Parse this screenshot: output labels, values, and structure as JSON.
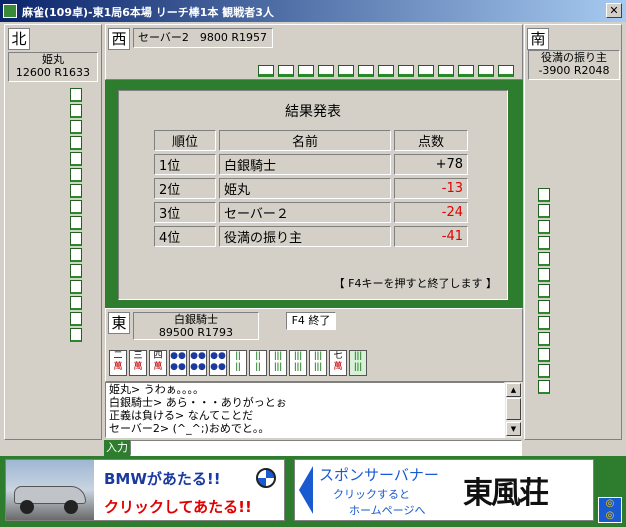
{
  "window": {
    "title": "麻雀(109卓)-東1局6本場 リーチ棒1本 観戦者3人",
    "close_glyph": "✕"
  },
  "north": {
    "wind": "北",
    "name": "姫丸",
    "score": "12600 R1633",
    "tiles_visible": 16
  },
  "west": {
    "wind": "西",
    "name_score": "セーバー2　9800 R1957",
    "tiles_visible": 13
  },
  "south": {
    "wind": "南",
    "name": "役満の振り主",
    "score": "-3900 R2048",
    "tiles_visible": 13
  },
  "east": {
    "wind": "東",
    "name": "白銀騎士",
    "score": "89500 R1793",
    "f4_label": "F4 終了"
  },
  "results": {
    "title": "結果発表",
    "headers": {
      "rank": "順位",
      "name": "名前",
      "points": "点数"
    },
    "rows": [
      {
        "rank": "1位",
        "name": "白銀騎士",
        "points": "+78"
      },
      {
        "rank": "2位",
        "name": "姫丸",
        "points": "-13"
      },
      {
        "rank": "3位",
        "name": "セーバー２",
        "points": "-24"
      },
      {
        "rank": "4位",
        "name": "役満の振り主",
        "points": "-41"
      }
    ],
    "footer": "【 F4キーを押すと終了します 】"
  },
  "hand": [
    {
      "top": "二",
      "bottom": "萬",
      "color": "#000"
    },
    {
      "top": "三",
      "bottom": "萬",
      "color": "#000"
    },
    {
      "top": "四",
      "bottom": "萬",
      "color": "#000"
    },
    {
      "top": "●●",
      "bottom": "●●",
      "color": "#1a3aa0"
    },
    {
      "top": "●●",
      "bottom": "●●",
      "color": "#1a3aa0"
    },
    {
      "top": "●●",
      "bottom": "●●",
      "color": "#1a3aa0"
    },
    {
      "top": "ǀǀ",
      "bottom": "ǀǀ",
      "color": "#1a7a1a"
    },
    {
      "top": "ǀǀ",
      "bottom": "ǀǀ",
      "color": "#1a7a1a"
    },
    {
      "top": "ǀǀǀ",
      "bottom": "ǀǀǀ",
      "color": "#1a7a1a"
    },
    {
      "top": "ǀǀǀ",
      "bottom": "ǀǀǀ",
      "color": "#1a7a1a"
    },
    {
      "top": "ǀǀǀ",
      "bottom": "ǀǀǀ",
      "color": "#1a7a1a"
    },
    {
      "top": "七",
      "bottom": "萬",
      "color": "#000"
    },
    {
      "top": "ǀǀǀ",
      "bottom": "ǀǀǀ",
      "color": "#1a7a1a"
    }
  ],
  "chat": {
    "lines": [
      "姫丸> うわぁ。。。。",
      "白銀騎士> あら・・・ありがっとぉ",
      "正義は負ける> なんてことだ",
      "セーバー2> (^_^;)おめでと。。"
    ],
    "input_label": "入力",
    "input_value": ""
  },
  "ads": {
    "bmw_line1": "BMWがあたる!!",
    "bmw_line2": "クリックしてあたる!!",
    "sponsor_line1": "スポンサーバナー",
    "sponsor_line2": "クリックすると",
    "sponsor_line3": "ホームページへ",
    "logo_text": "東風荘"
  }
}
